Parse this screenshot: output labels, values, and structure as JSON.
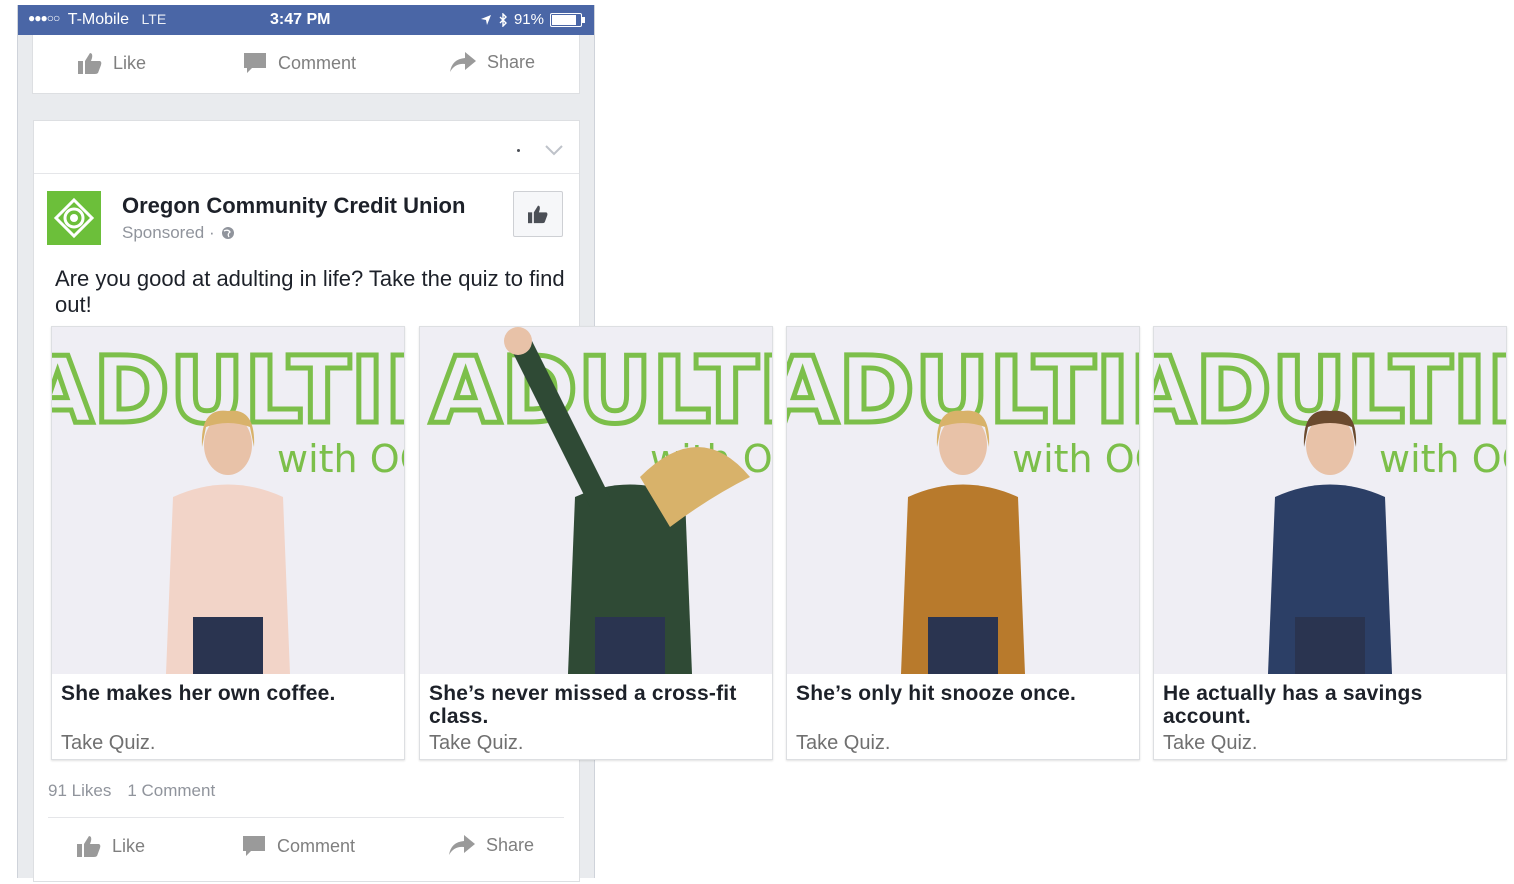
{
  "status_bar": {
    "signal_dots": "●●●○○",
    "carrier": "T-Mobile",
    "network": "LTE",
    "time": "3:47 PM",
    "battery": "91%",
    "battery_level": 0.91
  },
  "top_actions": {
    "like": "Like",
    "comment": "Comment",
    "share": "Share"
  },
  "post": {
    "page_name": "Oregon Community Credit Union",
    "sponsored": "Sponsored ·",
    "text": "Are you good at adulting in life? Take the quiz to find out!",
    "carousel": [
      {
        "headline": "She makes her own coffee.",
        "cta": "Take Quiz.",
        "shirt_color": "#f2d4c8",
        "pose": "coffee"
      },
      {
        "headline": "She’s never missed a cross-fit class.",
        "cta": "Take Quiz.",
        "shirt_color": "#2f4a35",
        "pose": "jump"
      },
      {
        "headline": "She’s only hit snooze once.",
        "cta": "Take Quiz.",
        "shirt_color": "#b87a2c",
        "pose": "snooze"
      },
      {
        "headline": "He actually has a savings account.",
        "cta": "Take Quiz.",
        "shirt_color": "#2c3f66",
        "pose": "savings"
      }
    ],
    "backdrop_text": "ADULTING",
    "backdrop_sub": "with OCCU",
    "backdrop_color": "#7cbf4a",
    "likes": "91 Likes",
    "comments": "1 Comment"
  },
  "bottom_actions": {
    "like": "Like",
    "comment": "Comment",
    "share": "Share"
  },
  "colors": {
    "status_bar": "#4a66a6",
    "brand_green": "#6cbf3a",
    "muted_text": "#90949c"
  }
}
